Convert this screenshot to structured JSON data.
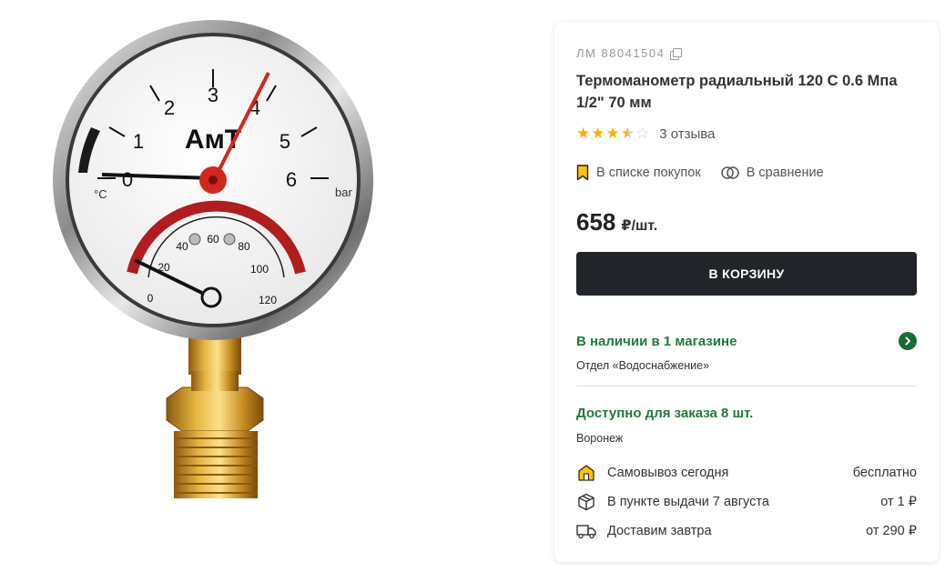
{
  "product": {
    "sku": "ЛМ 88041504",
    "title": "Термоманометр радиальный 120 С 0.6 Мпа 1/2\" 70 мм",
    "rating": 3.5,
    "reviews_label": "3 отзыва"
  },
  "image": {
    "brand": "АмТ",
    "pressure_ticks": [
      "0",
      "1",
      "2",
      "3",
      "4",
      "5",
      "6"
    ],
    "pressure_unit": "bar",
    "temp_ticks": [
      "0",
      "20",
      "40",
      "60",
      "80",
      "100",
      "120"
    ],
    "temp_unit": "°C"
  },
  "actions": {
    "shopping_list": "В списке покупок",
    "compare": "В сравнение"
  },
  "price": {
    "value": "658",
    "unit": "₽/шт."
  },
  "cart_button": "В КОРЗИНУ",
  "availability": {
    "title": "В наличии в 1 магазине",
    "department": "Отдел «Водоснабжение»"
  },
  "order": {
    "title": "Доступно для заказа 8 шт.",
    "city": "Воронеж"
  },
  "delivery": [
    {
      "icon": "pickup-store-icon",
      "label": "Самовывоз сегодня",
      "price": "бесплатно"
    },
    {
      "icon": "parcel-box-icon",
      "label": "В пункте выдачи 7 августа",
      "price": "от 1 ₽"
    },
    {
      "icon": "truck-icon",
      "label": "Доставим завтра",
      "price": "от 290 ₽"
    }
  ],
  "colors": {
    "accent_green": "#1f7a3e",
    "button_dark": "#212529",
    "star": "#f5b400"
  }
}
